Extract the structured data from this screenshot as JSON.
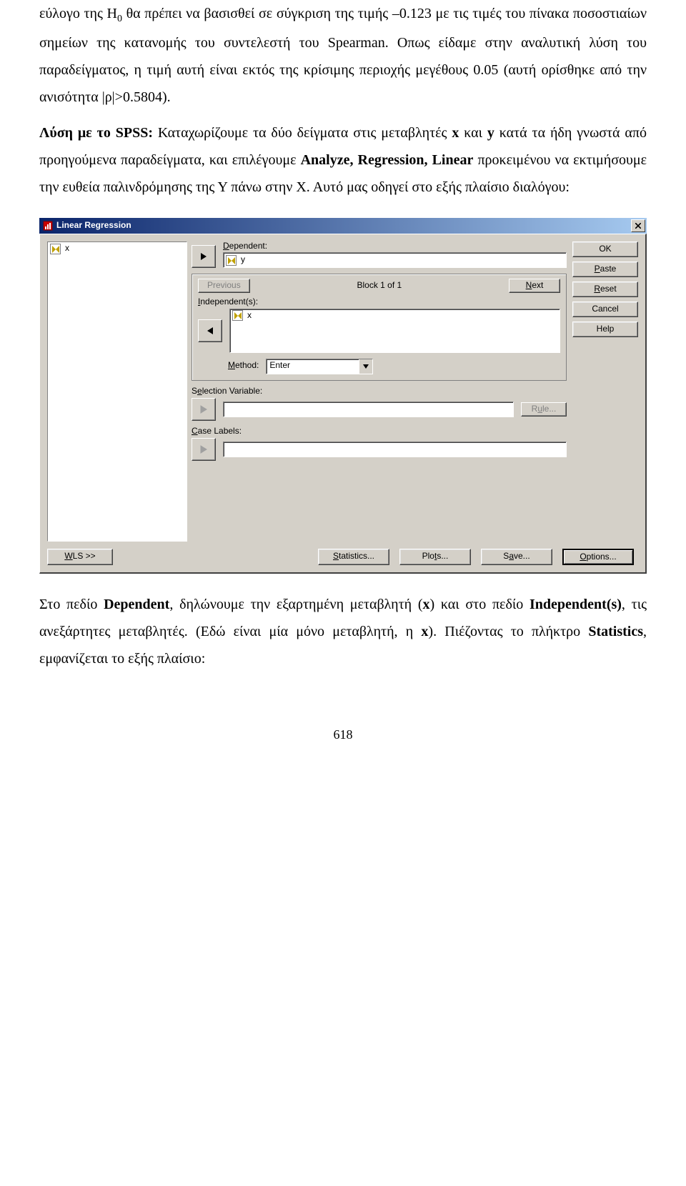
{
  "text": {
    "p1a": "εύλογο της Η",
    "p1sub": "0",
    "p1b": " θα πρέπει να βασισθεί σε σύγκριση της τιμής –0.123 με τις τιμές του πίνακα ποσοστιαίων σημείων της κατανομής του συντελεστή του Spearman. Οπως είδαμε στην αναλυτική λύση του παραδείγματος, η τιμή αυτή είναι εκτός της κρίσιμης περιοχής μεγέθους 0.05 (αυτή ορίσθηκε από την ανισότητα |ρ|>0.5804).",
    "p2a": "Λύση με το SPSS:",
    "p2b": " Καταχωρίζουμε τα δύο δείγματα στις μεταβλητές ",
    "p2c": "x",
    "p2d": " και ",
    "p2e": "y",
    "p2f": " κατά τα ήδη γνωστά από προηγούμενα παραδείγματα, και επιλέγουμε ",
    "p2g": "Analyze, Regression, Linear",
    "p2h": " προκειμένου να εκτιμήσουμε την ευθεία παλινδρόμησης της Υ πάνω στην Χ. Αυτό μας οδηγεί στο εξής πλαίσιο διαλόγου:",
    "p3a": "Στο πεδίο ",
    "p3b": "Dependent",
    "p3c": ", δηλώνουμε την εξαρτημένη μεταβλητή (",
    "p3d": "x",
    "p3e": ") και στο πεδίο ",
    "p3f": "Independent(s)",
    "p3g": ", τις ανεξάρτητες μεταβλητές. (Εδώ είναι μία μόνο μεταβλητή, η ",
    "p3h": "x",
    "p3i": "). Πιέζοντας το πλήκτρο ",
    "p3j": "Statistics",
    "p3k": ", εμφανίζεται το εξής πλαίσιο:",
    "pageno": "618"
  },
  "dialog": {
    "title": "Linear Regression",
    "source_var": "x",
    "dependent_label": "Dependent:",
    "dependent_value": "y",
    "previous": "Previous",
    "block_label": "Block 1 of 1",
    "next": "Next",
    "independent_label": "Independent(s):",
    "independent_value": "x",
    "method_label": "Method:",
    "method_value": "Enter",
    "selection_label": "Selection Variable:",
    "rule": "Rule...",
    "case_label": "Case Labels:",
    "wls": "WLS >>",
    "statistics": "Statistics...",
    "plots": "Plots...",
    "save": "Save...",
    "options": "Options...",
    "buttons": {
      "ok": "OK",
      "paste": "Paste",
      "reset": "Reset",
      "cancel": "Cancel",
      "help": "Help"
    }
  }
}
